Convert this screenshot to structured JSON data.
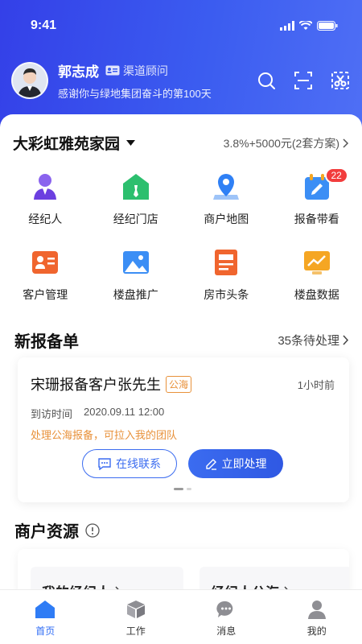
{
  "status_bar": {
    "time": "9:41"
  },
  "profile": {
    "name": "郭志成",
    "role": "渠道顾问",
    "subtitle": "感谢你与绿地集团奋斗的第100天"
  },
  "header_icons": [
    "search-icon",
    "scan-icon",
    "scissors-icon"
  ],
  "project": {
    "name": "大彩虹雅苑家园",
    "commission": "3.8%+5000元(2套方案)"
  },
  "grid": [
    {
      "label": "经纪人",
      "icon": "agent-icon",
      "color": "#7b4ee6"
    },
    {
      "label": "经纪门店",
      "icon": "store-icon",
      "color": "#2cbf6e"
    },
    {
      "label": "商户地图",
      "icon": "map-pin-icon",
      "color": "#2f80f5"
    },
    {
      "label": "报备带看",
      "icon": "report-icon",
      "color": "#3b8ef5",
      "badge": "22"
    },
    {
      "label": "客户管理",
      "icon": "customer-card-icon",
      "color": "#f0652e"
    },
    {
      "label": "楼盘推广",
      "icon": "image-icon",
      "color": "#3b8ef5"
    },
    {
      "label": "房市头条",
      "icon": "news-icon",
      "color": "#f0652e"
    },
    {
      "label": "楼盘数据",
      "icon": "chart-icon",
      "color": "#f5a623"
    }
  ],
  "new_reports": {
    "title": "新报备单",
    "pending_link": "35条待处理",
    "card": {
      "title": "宋珊报备客户张先生",
      "tag": "公海",
      "time_ago": "1小时前",
      "visit_label": "到访时间",
      "visit_time": "2020.09.11 12:00",
      "warning": "处理公海报备，可拉入我的团队",
      "btn_contact": "在线联系",
      "btn_process": "立即处理"
    }
  },
  "merchant": {
    "title": "商户资源",
    "my_agents": "我的经纪人",
    "agent_pool": "经纪人公海"
  },
  "tabs": [
    {
      "label": "首页",
      "icon": "home-icon",
      "active": true
    },
    {
      "label": "工作",
      "icon": "cube-icon",
      "active": false
    },
    {
      "label": "消息",
      "icon": "chat-icon",
      "active": false
    },
    {
      "label": "我的",
      "icon": "user-icon",
      "active": false
    }
  ]
}
